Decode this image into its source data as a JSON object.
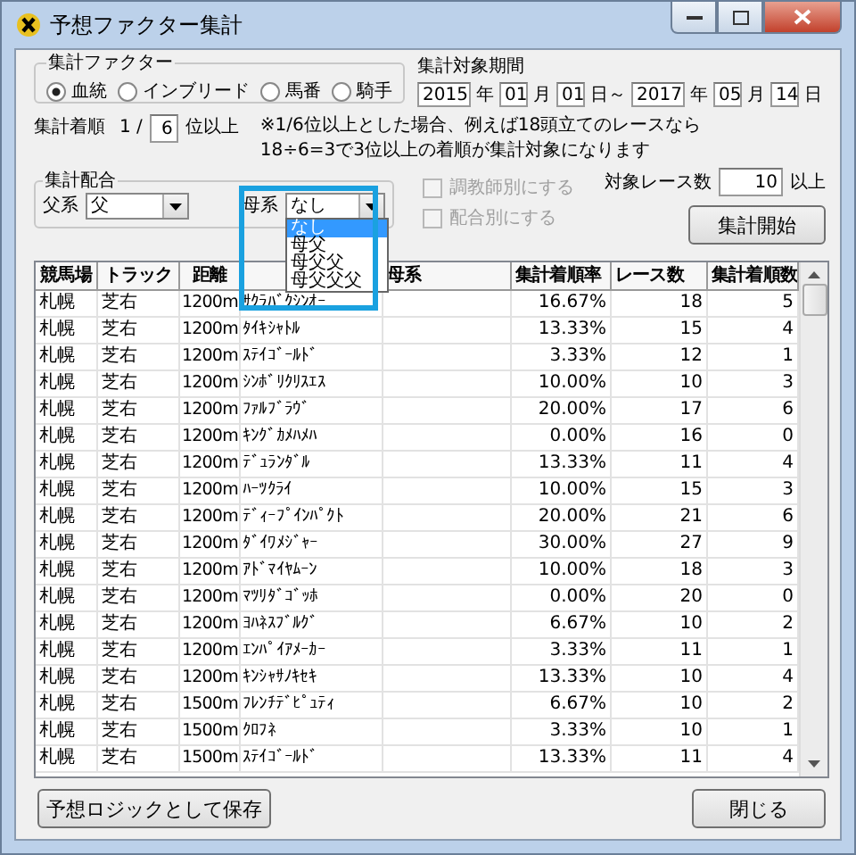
{
  "window": {
    "title": "予想ファクター集計"
  },
  "factor_group": {
    "label": "集計ファクター",
    "options": [
      {
        "label": "血統",
        "selected": true
      },
      {
        "label": "インブリード",
        "selected": false
      },
      {
        "label": "馬番",
        "selected": false
      },
      {
        "label": "騎手",
        "selected": false
      }
    ]
  },
  "period": {
    "label": "集計対象期間",
    "fields": [
      {
        "value": "2015",
        "unit": "年"
      },
      {
        "value": "01",
        "unit": "月"
      },
      {
        "value": "01",
        "unit": "日～"
      },
      {
        "value": "2017",
        "unit": "年"
      },
      {
        "value": "05",
        "unit": "月"
      },
      {
        "value": "14",
        "unit": "日"
      }
    ]
  },
  "rank": {
    "label": "集計着順",
    "prefix": "1 /",
    "value": "6",
    "suffix": "位以上",
    "note": [
      "※1/6位以上とした場合、例えば18頭立てのレースなら",
      "18÷6=3で3位以上の着順が集計対象になります"
    ]
  },
  "mating_group": {
    "label": "集計配合",
    "sire": {
      "label": "父系",
      "value": "父"
    },
    "dam": {
      "label": "母系",
      "value": "なし",
      "expanded": true,
      "options": [
        {
          "label": "なし",
          "selected": true
        },
        {
          "label": "母父",
          "selected": false
        },
        {
          "label": "母父父",
          "selected": false
        },
        {
          "label": "母父父父",
          "selected": false
        }
      ]
    }
  },
  "checkboxes": [
    {
      "label": "調教師別にする",
      "checked": false,
      "disabled": true
    },
    {
      "label": "配合別にする",
      "checked": false,
      "disabled": true
    }
  ],
  "race_count": {
    "label": "対象レース数",
    "value": "10",
    "suffix": "以上"
  },
  "start_button": "集計開始",
  "table": {
    "columns": [
      {
        "label": "競馬場"
      },
      {
        "label": "トラック"
      },
      {
        "label": "距離"
      },
      {},
      {
        "label": "母系"
      },
      {
        "label": "集計着順率"
      },
      {
        "label": "レース数"
      },
      {
        "label": "集計着順数"
      }
    ],
    "rows": [
      [
        "札幌",
        "芝右",
        "1200m",
        "ｻｸﾗﾊﾞｸｼﾝｵｰ",
        "",
        "16.67%",
        "18",
        "5"
      ],
      [
        "札幌",
        "芝右",
        "1200m",
        "ﾀｲｷｼｬﾄﾙ",
        "",
        "13.33%",
        "15",
        "4"
      ],
      [
        "札幌",
        "芝右",
        "1200m",
        "ｽﾃｲｺﾞｰﾙﾄﾞ",
        "",
        "3.33%",
        "12",
        "1"
      ],
      [
        "札幌",
        "芝右",
        "1200m",
        "ｼﾝﾎﾞﾘｸﾘｽｴｽ",
        "",
        "10.00%",
        "10",
        "3"
      ],
      [
        "札幌",
        "芝右",
        "1200m",
        "ﾌｧﾙﾌﾞﾗｳﾞ",
        "",
        "20.00%",
        "17",
        "6"
      ],
      [
        "札幌",
        "芝右",
        "1200m",
        "ｷﾝｸﾞｶﾒﾊﾒﾊ",
        "",
        "0.00%",
        "16",
        "0"
      ],
      [
        "札幌",
        "芝右",
        "1200m",
        "ﾃﾞｭﾗﾝﾀﾞﾙ",
        "",
        "13.33%",
        "11",
        "4"
      ],
      [
        "札幌",
        "芝右",
        "1200m",
        "ﾊｰﾂｸﾗｲ",
        "",
        "10.00%",
        "15",
        "3"
      ],
      [
        "札幌",
        "芝右",
        "1200m",
        "ﾃﾞｨｰﾌﾟｲﾝﾊﾟｸﾄ",
        "",
        "20.00%",
        "21",
        "6"
      ],
      [
        "札幌",
        "芝右",
        "1200m",
        "ﾀﾞｲﾜﾒｼﾞｬｰ",
        "",
        "30.00%",
        "27",
        "9"
      ],
      [
        "札幌",
        "芝右",
        "1200m",
        "ｱﾄﾞﾏｲﾔﾑｰﾝ",
        "",
        "10.00%",
        "18",
        "3"
      ],
      [
        "札幌",
        "芝右",
        "1200m",
        "ﾏﾂﾘﾀﾞｺﾞｯﾎ",
        "",
        "0.00%",
        "20",
        "0"
      ],
      [
        "札幌",
        "芝右",
        "1200m",
        "ﾖﾊﾈｽﾌﾞﾙｸﾞ",
        "",
        "6.67%",
        "10",
        "2"
      ],
      [
        "札幌",
        "芝右",
        "1200m",
        "ｴﾝﾊﾟｲｱﾒｰｶｰ",
        "",
        "3.33%",
        "11",
        "1"
      ],
      [
        "札幌",
        "芝右",
        "1200m",
        "ｷﾝｼｬｻﾉｷｾｷ",
        "",
        "13.33%",
        "10",
        "4"
      ],
      [
        "札幌",
        "芝右",
        "1500m",
        "ﾌﾚﾝﾁﾃﾞﾋﾟｭﾃｨ",
        "",
        "6.67%",
        "10",
        "2"
      ],
      [
        "札幌",
        "芝右",
        "1500m",
        "ｸﾛﾌﾈ",
        "",
        "3.33%",
        "10",
        "1"
      ],
      [
        "札幌",
        "芝右",
        "1500m",
        "ｽﾃｲｺﾞｰﾙﾄﾞ",
        "",
        "13.33%",
        "11",
        "4"
      ]
    ]
  },
  "save_button": "予想ロジックとして保存",
  "close_button": "閉じる"
}
